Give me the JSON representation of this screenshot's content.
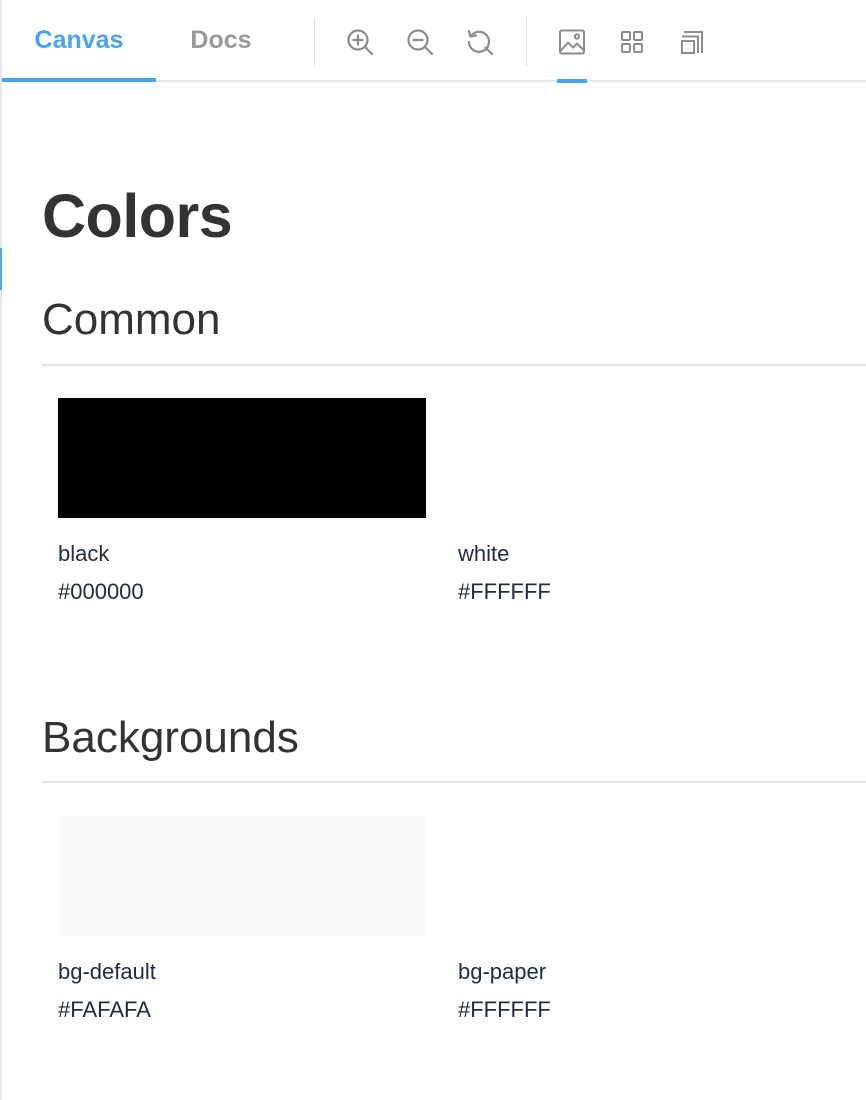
{
  "toolbar": {
    "tabs": [
      {
        "label": "Canvas",
        "active": true
      },
      {
        "label": "Docs",
        "active": false
      }
    ],
    "tools": [
      {
        "icon": "zoom-in-icon"
      },
      {
        "icon": "zoom-out-icon"
      },
      {
        "icon": "reset-zoom-icon"
      },
      {
        "icon": "image-background-icon",
        "active": true
      },
      {
        "icon": "grid-icon"
      },
      {
        "icon": "outline-icon"
      }
    ]
  },
  "page": {
    "title": "Colors"
  },
  "sections": [
    {
      "title": "Common",
      "swatches": [
        {
          "name": "black",
          "value": "#000000",
          "color": "#000000"
        },
        {
          "name": "white",
          "value": "#FFFFFF",
          "color": "#FFFFFF"
        }
      ]
    },
    {
      "title": "Backgrounds",
      "swatches": [
        {
          "name": "bg-default",
          "value": "#FAFAFA",
          "color": "#FAFAFA"
        },
        {
          "name": "bg-paper",
          "value": "#FFFFFF",
          "color": "#FFFFFF"
        }
      ]
    }
  ],
  "colors": {
    "accent": "#4aa3f0",
    "heading": "#333333",
    "label": "#1f2d3d",
    "inactive_tab": "#999999"
  }
}
